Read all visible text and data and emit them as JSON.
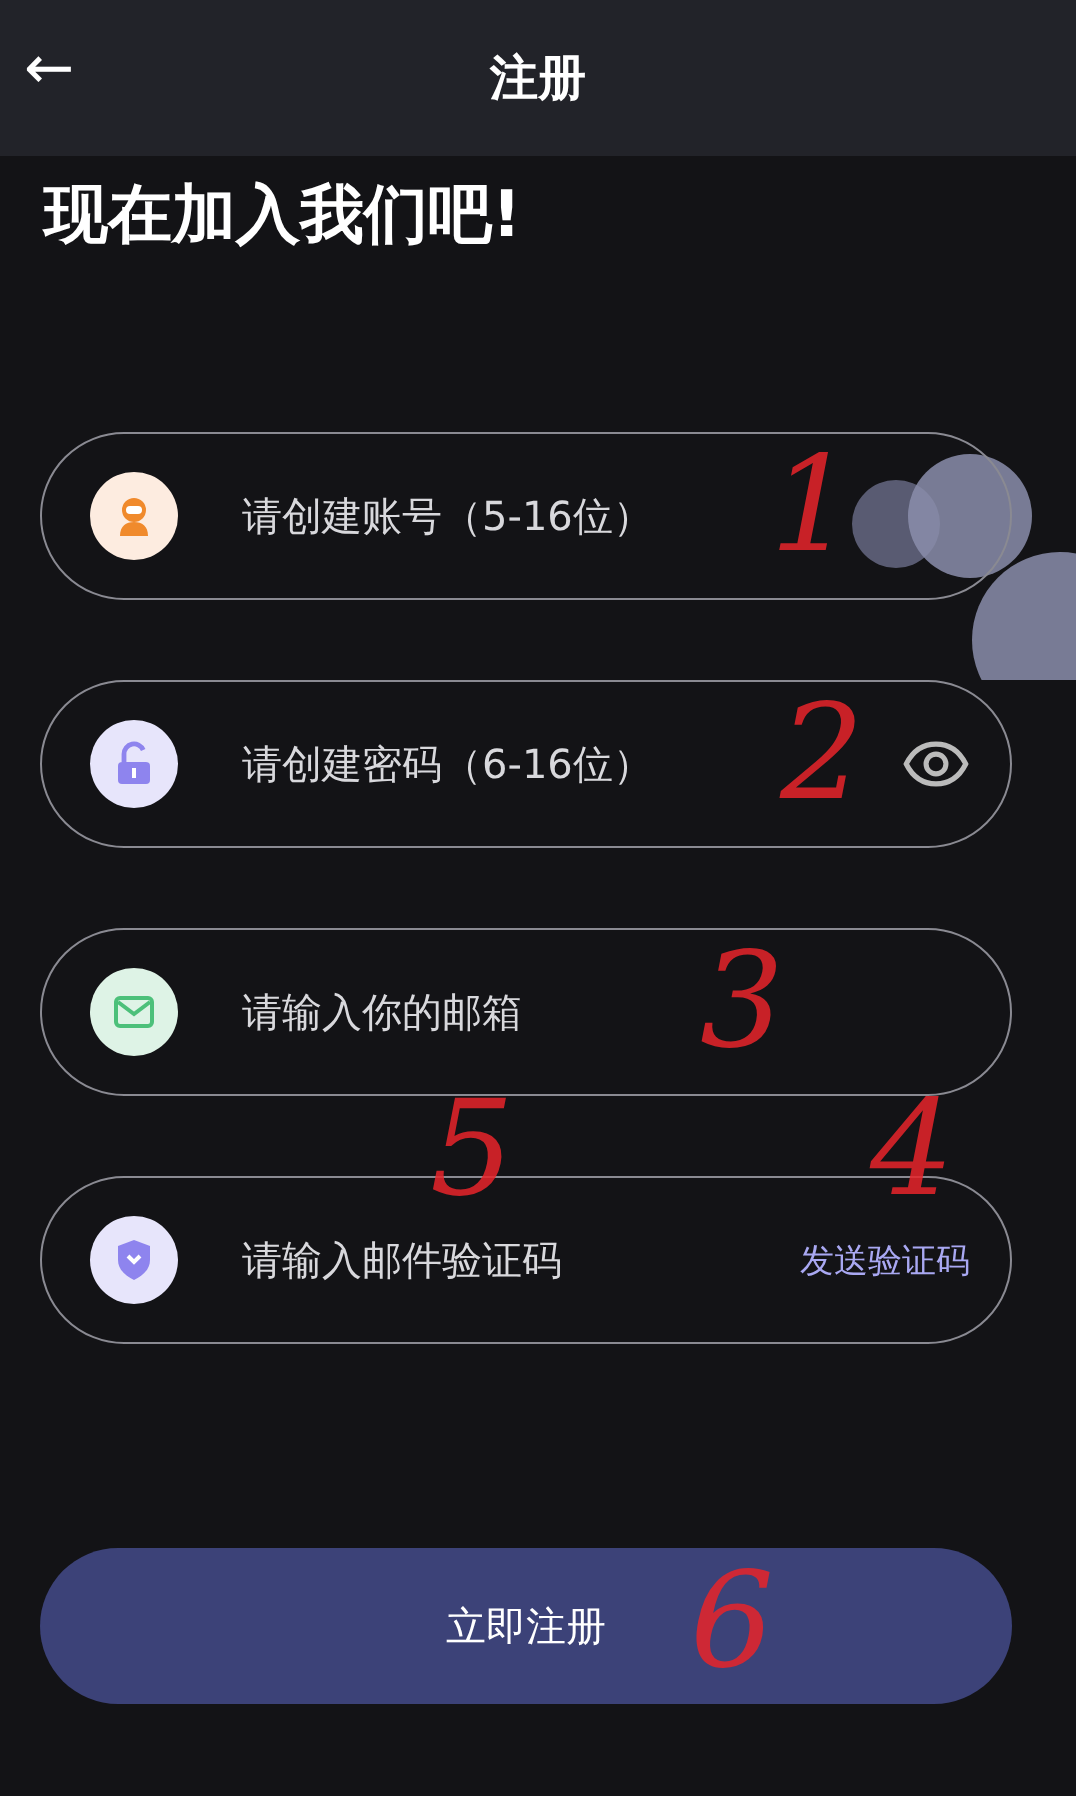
{
  "header": {
    "back_icon": "←",
    "title": "注册"
  },
  "heading": "现在加入我们吧!",
  "fields": [
    {
      "kind": "account",
      "placeholder": "请创建账号（5-16位）",
      "annotations": [
        "1"
      ]
    },
    {
      "kind": "password",
      "placeholder": "请创建密码（6-16位）",
      "annotations": [
        "2"
      ]
    },
    {
      "kind": "email",
      "placeholder": "请输入你的邮箱",
      "annotations": [
        "3"
      ]
    },
    {
      "kind": "code",
      "placeholder": "请输入邮件验证码",
      "action": "发送验证码",
      "annotations": [
        "5",
        "4"
      ]
    }
  ],
  "submit": {
    "label": "立即注册",
    "annotations": [
      "6"
    ]
  }
}
